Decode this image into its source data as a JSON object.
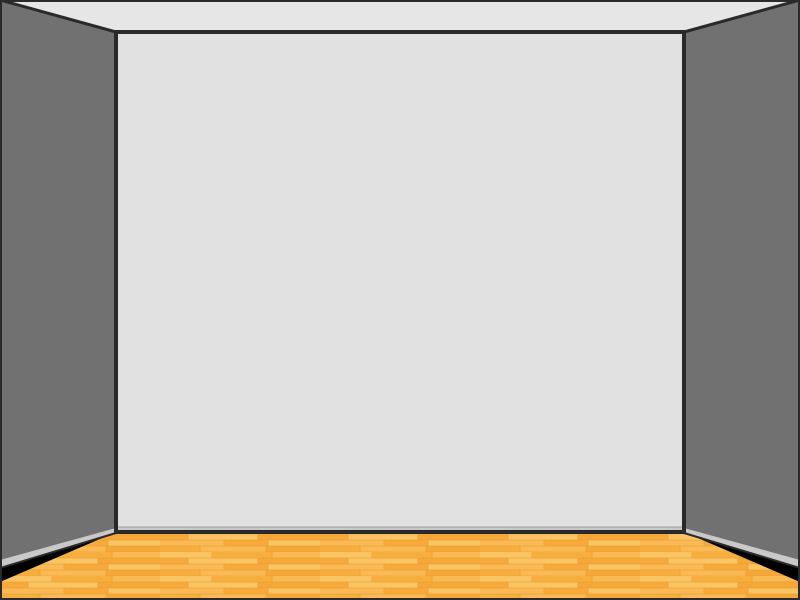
{
  "scene": {
    "type": "empty-room",
    "colors": {
      "ceiling": "#e6e6e6",
      "back_wall": "#e1e1e1",
      "side_walls": "#717171",
      "edges": "#2a2a2a",
      "baseboard": "#c9c9c9",
      "floor": "#f8b043",
      "floor_light": "#fbc463",
      "floor_dark": "#e59a2c"
    }
  }
}
